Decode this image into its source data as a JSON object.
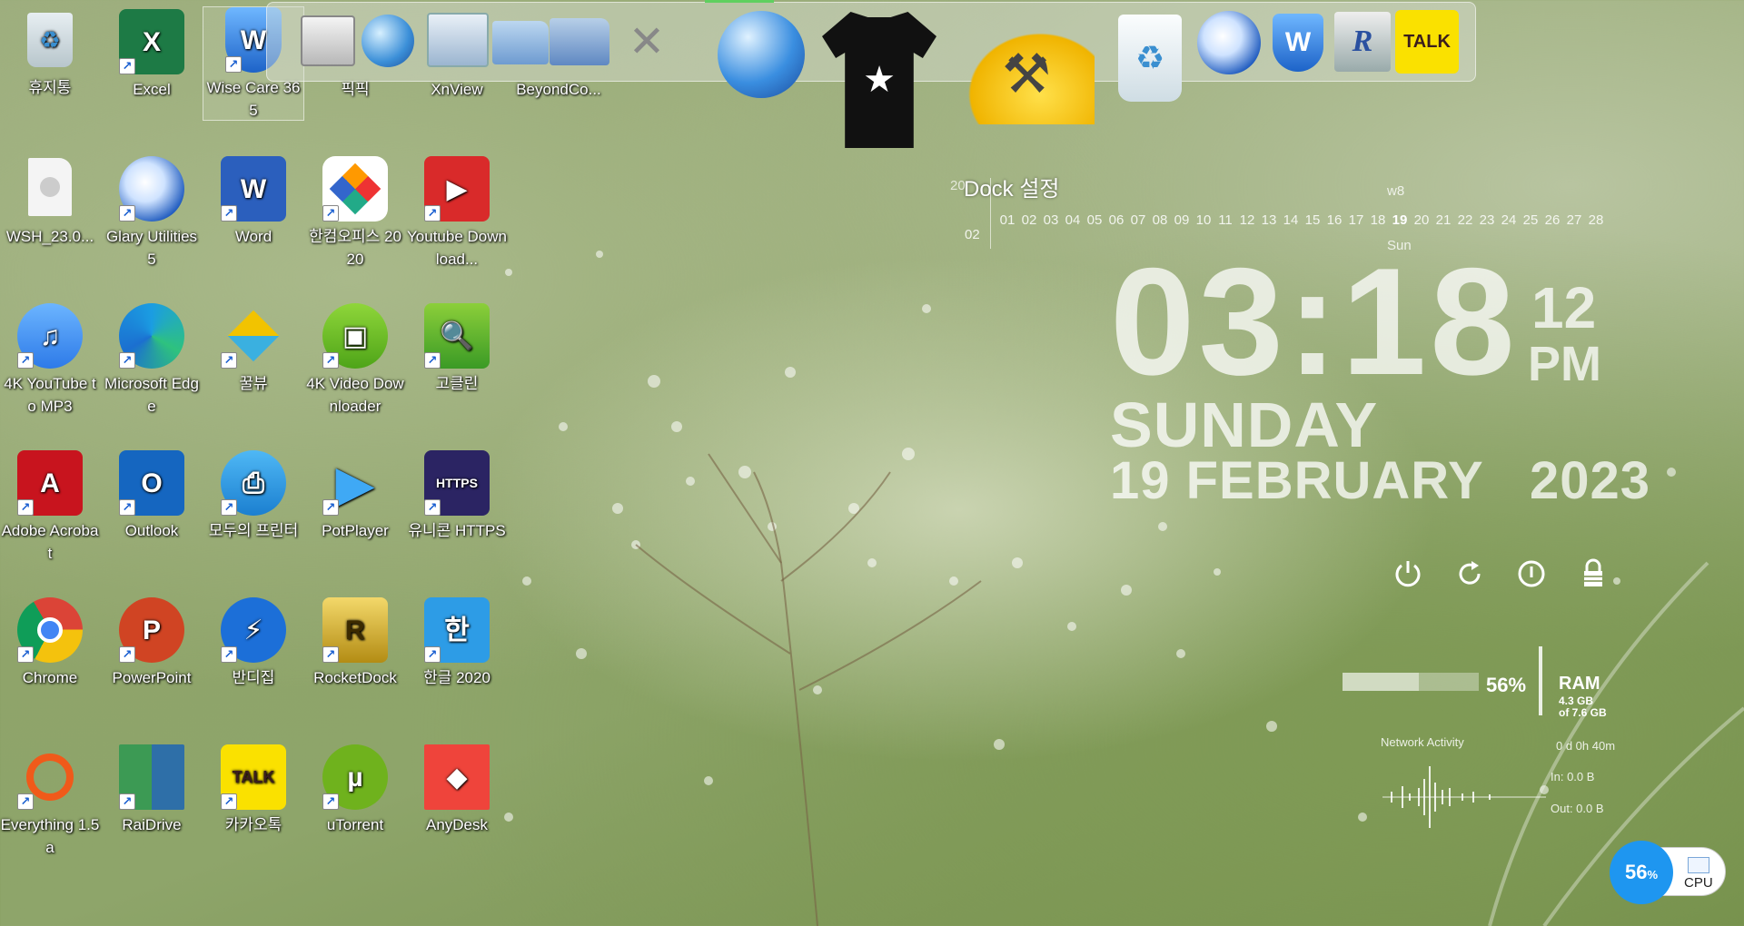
{
  "desktop": {
    "icons": [
      {
        "label": "휴지통",
        "icon": "recycle-bin-icon"
      },
      {
        "label": "Excel",
        "icon": "excel-icon"
      },
      {
        "label": "Wise Care 365",
        "icon": "wise-care-icon"
      },
      {
        "label": "픽픽",
        "icon": "picpick-icon"
      },
      {
        "label": "XnView",
        "icon": "xnview-icon"
      },
      {
        "label": "BeyondCo...",
        "icon": "beyond-compare-icon"
      },
      {
        "label": "WSH_23.0...",
        "icon": "file-icon"
      },
      {
        "label": "Glary Utilities 5",
        "icon": "glary-utilities-icon"
      },
      {
        "label": "Word",
        "icon": "word-icon"
      },
      {
        "label": "한컴오피스 2020",
        "icon": "hancom-office-icon"
      },
      {
        "label": "Youtube Download...",
        "icon": "youtube-downloader-icon"
      },
      {
        "label": "4K YouTube to MP3",
        "icon": "4k-youtube-mp3-icon"
      },
      {
        "label": "Microsoft Edge",
        "icon": "edge-icon"
      },
      {
        "label": "꿀뷰",
        "icon": "honeyview-icon"
      },
      {
        "label": "4K Video Downloader",
        "icon": "4k-video-downloader-icon"
      },
      {
        "label": "고클린",
        "icon": "goclean-icon"
      },
      {
        "label": "Adobe Acrobat",
        "icon": "acrobat-icon"
      },
      {
        "label": "Outlook",
        "icon": "outlook-icon"
      },
      {
        "label": "모두의 프린터",
        "icon": "printer-icon"
      },
      {
        "label": "PotPlayer",
        "icon": "potplayer-icon"
      },
      {
        "label": "유니콘 HTTPS",
        "icon": "unicorn-https-icon"
      },
      {
        "label": "Chrome",
        "icon": "chrome-icon"
      },
      {
        "label": "PowerPoint",
        "icon": "powerpoint-icon"
      },
      {
        "label": "반디집",
        "icon": "bandizip-icon"
      },
      {
        "label": "RocketDock",
        "icon": "rocketdock-icon"
      },
      {
        "label": "한글 2020",
        "icon": "hangul-icon"
      },
      {
        "label": "Everything 1.5a",
        "icon": "everything-icon"
      },
      {
        "label": "RaiDrive",
        "icon": "raidrive-icon"
      },
      {
        "label": "카카오톡",
        "icon": "kakaotalk-icon"
      },
      {
        "label": "uTorrent",
        "icon": "utorrent-icon"
      },
      {
        "label": "AnyDesk",
        "icon": "anydesk-icon"
      }
    ]
  },
  "dock": {
    "settings_label": "Dock 설정",
    "kakao_label": "TALK",
    "items": [
      "screen-capture-icon",
      "network-globe-icon",
      "file-manager-icon",
      "folder-icon",
      "folder-icon",
      "tools-icon",
      "globe-icon",
      "tshirt-icon",
      "hammer-icon",
      "recycle-bin-icon",
      "glary-icon",
      "wise-icon",
      "registry-icon",
      "kakaotalk-icon"
    ]
  },
  "calendar": {
    "year_prefix": "20",
    "month": "02",
    "week": "w8",
    "weekday": "Sun",
    "days": [
      "01",
      "02",
      "03",
      "04",
      "05",
      "06",
      "07",
      "08",
      "09",
      "10",
      "11",
      "12",
      "13",
      "14",
      "15",
      "16",
      "17",
      "18",
      "19",
      "20",
      "21",
      "22",
      "23",
      "24",
      "25",
      "26",
      "27",
      "28"
    ],
    "today": "19"
  },
  "clock": {
    "time": "03:18",
    "seconds": "12",
    "ampm": "PM",
    "day": "SUNDAY",
    "date": "19 FEBRUARY   2023"
  },
  "power": [
    "power-icon",
    "restart-icon",
    "shutdown-icon",
    "lock-icon"
  ],
  "sysmon": {
    "ram_percent": "56%",
    "ram_fraction": 0.56,
    "ram_label": "RAM",
    "ram_used": "4.3 GB",
    "ram_total": "of 7.6 GB",
    "net_title": "Network Activity",
    "uptime": "0 d 0h 40m",
    "net_in": "In: 0.0 B",
    "net_out": "Out: 0.0 B"
  },
  "cpu": {
    "percent": "56",
    "percent_sign": "%",
    "label": "CPU"
  },
  "colors": {
    "accent_blue": "#1e96f0",
    "dock_indicator": "#5fd05f"
  }
}
